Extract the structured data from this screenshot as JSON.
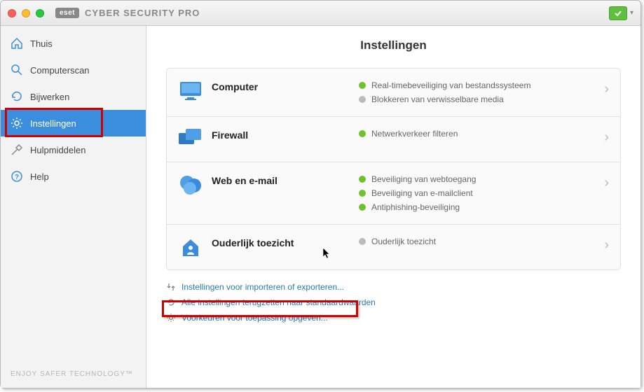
{
  "header": {
    "brand_badge": "eset",
    "brand_name": "CYBER SECURITY PRO"
  },
  "sidebar": {
    "items": [
      {
        "label": "Thuis"
      },
      {
        "label": "Computerscan"
      },
      {
        "label": "Bijwerken"
      },
      {
        "label": "Instellingen",
        "active": true
      },
      {
        "label": "Hulpmiddelen"
      },
      {
        "label": "Help"
      }
    ],
    "footer": "ENJOY SAFER TECHNOLOGY™"
  },
  "main": {
    "title": "Instellingen",
    "cards": [
      {
        "title": "Computer",
        "details": [
          {
            "status": "green",
            "text": "Real-timebeveiliging van bestandssysteem"
          },
          {
            "status": "grey",
            "text": "Blokkeren van verwisselbare media"
          }
        ]
      },
      {
        "title": "Firewall",
        "details": [
          {
            "status": "green",
            "text": "Netwerkverkeer filteren"
          }
        ]
      },
      {
        "title": "Web en e-mail",
        "details": [
          {
            "status": "green",
            "text": "Beveiliging van webtoegang"
          },
          {
            "status": "green",
            "text": "Beveiliging van e-mailclient"
          },
          {
            "status": "green",
            "text": "Antiphishing-beveiliging"
          }
        ]
      },
      {
        "title": "Ouderlijk toezicht",
        "details": [
          {
            "status": "grey",
            "text": "Ouderlijk toezicht"
          }
        ]
      }
    ],
    "links": [
      {
        "text": "Instellingen voor importeren of exporteren..."
      },
      {
        "text": "Alle instellingen terugzetten naar standaardwaarden"
      },
      {
        "text": "Voorkeuren voor toepassing opgeven..."
      }
    ]
  }
}
